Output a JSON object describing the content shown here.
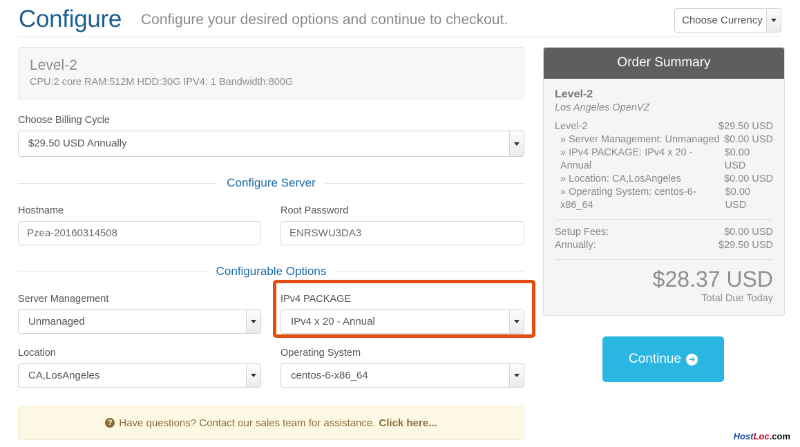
{
  "header": {
    "title": "Configure",
    "subtitle": "Configure your desired options and continue to checkout.",
    "currency_selected": "Choose Currency"
  },
  "product": {
    "name": "Level-2",
    "specs": "CPU:2 core RAM:512M HDD:30G IPV4: 1 Bandwidth:800G"
  },
  "billing": {
    "label": "Choose Billing Cycle",
    "selected": "$29.50 USD Annually"
  },
  "configure_server": {
    "section_title": "Configure Server",
    "hostname_label": "Hostname",
    "hostname_value": "Pzea-20160314508",
    "root_password_label": "Root Password",
    "root_password_value": "ENRSWU3DA3"
  },
  "configurable_options": {
    "section_title": "Configurable Options",
    "server_management_label": "Server Management",
    "server_management_selected": "Unmanaged",
    "ipv4_package_label": "IPv4 PACKAGE",
    "ipv4_package_selected": "IPv4 x 20 - Annual",
    "location_label": "Location",
    "location_selected": "CA,LosAngeles",
    "operating_system_label": "Operating System",
    "operating_system_selected": "centos-6-x86_64",
    "highlight_color": "#e24d10"
  },
  "help_banner": {
    "icon": "question-circle-icon",
    "text": "Have questions? Contact our sales team for assistance.",
    "link_text": "Click here..."
  },
  "order_summary": {
    "heading": "Order Summary",
    "product_name": "Level-2",
    "product_sub": "Los Angeles OpenVZ",
    "lines": [
      {
        "label": "Level-2",
        "amount": "$29.50 USD"
      },
      {
        "label": "» Server Management: Unmanaged",
        "amount": "$0.00 USD"
      },
      {
        "label": "» IPv4 PACKAGE: IPv4 x 20 - Annual",
        "amount": "$0.00 USD"
      },
      {
        "label": "» Location: CA,LosAngeles",
        "amount": "$0.00 USD"
      },
      {
        "label": "» Operating System: centos-6-x86_64",
        "amount": "$0.00 USD"
      }
    ],
    "setup_fees_label": "Setup Fees:",
    "setup_fees_amount": "$0.00 USD",
    "recurring_label": "Annually:",
    "recurring_amount": "$29.50 USD",
    "total_amount": "$28.37 USD",
    "total_caption": "Total Due Today"
  },
  "continue_button": {
    "label": "Continue",
    "icon": "arrow-circle-right-icon",
    "color": "#29b6e0"
  },
  "watermark": {
    "part1": "Host",
    "part2": "Loc",
    "part3": ".com"
  }
}
